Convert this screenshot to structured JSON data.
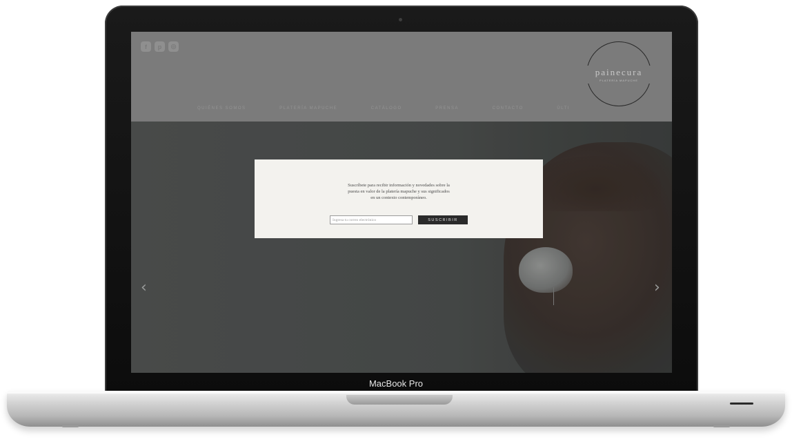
{
  "device": {
    "label": "MacBook Pro"
  },
  "header": {
    "social_icons": [
      {
        "icon": "facebook-icon",
        "glyph": "f"
      },
      {
        "icon": "pinterest-icon",
        "glyph": "p"
      },
      {
        "icon": "instagram-icon",
        "glyph": "◎"
      }
    ],
    "logo": {
      "name": "painecura",
      "subtitle": "PLATERÍA MAPUCHE"
    },
    "nav": [
      {
        "label": "QUIÉNES SOMOS"
      },
      {
        "label": "PLATERÍA MAPUCHE"
      },
      {
        "label": "CATÁLOGO"
      },
      {
        "label": "PRENSA"
      },
      {
        "label": "CONTACTO"
      },
      {
        "label": "ÚLTI"
      }
    ]
  },
  "hero": {
    "prev_glyph": "‹",
    "next_glyph": "›"
  },
  "modal": {
    "text_line1": "Suscríbete para recibir información y novedades sobre la",
    "text_line2": "puesta en valor de la platería mapuche y sus significados",
    "text_line3": "en un contexto contemporáneo.",
    "email_placeholder": "Ingresa tu correo electrónico",
    "submit_label": "SUSCRIBIR"
  },
  "colors": {
    "header_bg": "#8d8d8d",
    "hero_bg": "#4e5150",
    "modal_bg": "#f3f2ee",
    "button_bg": "#2a2a2a"
  }
}
